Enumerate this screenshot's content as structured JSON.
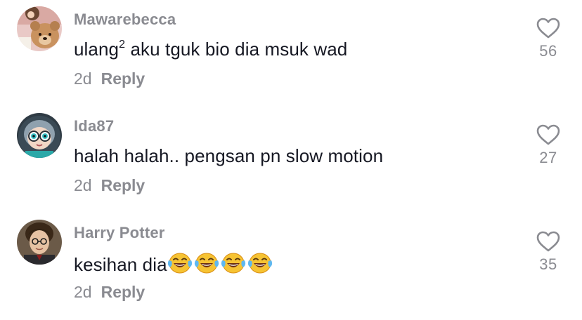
{
  "comments": [
    {
      "username": "Mawarebecca",
      "text_main": "ulang",
      "text_sup": "2",
      "text_rest": " aku tguk bio dia msuk wad",
      "time": "2d",
      "reply_label": "Reply",
      "likes": "56",
      "avatar_icon": "teddy-bear-avatar-icon"
    },
    {
      "username": "Ida87",
      "text_main": "halah halah.. pengsan pn slow motion",
      "time": "2d",
      "reply_label": "Reply",
      "likes": "27",
      "avatar_icon": "cartoon-girl-avatar-icon"
    },
    {
      "username": "Harry Potter",
      "text_main": "kesihan dia",
      "emojis": [
        "face-with-tears-of-joy",
        "face-with-tears-of-joy",
        "face-with-tears-of-joy",
        "face-with-tears-of-joy"
      ],
      "time": "2d",
      "reply_label": "Reply",
      "likes": "35",
      "avatar_icon": "portrait-avatar-icon"
    }
  ],
  "colors": {
    "text": "#161823",
    "muted": "#8a8b91",
    "emoji": "#f5b72f"
  }
}
